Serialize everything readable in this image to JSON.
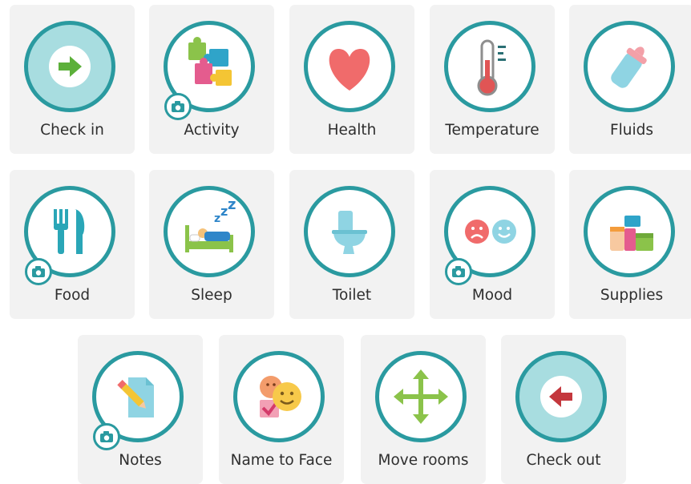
{
  "tiles": [
    {
      "label": "Check in",
      "icon": "arrow-right-icon"
    },
    {
      "label": "Activity",
      "icon": "puzzle-icon"
    },
    {
      "label": "Health",
      "icon": "heart-icon"
    },
    {
      "label": "Temperature",
      "icon": "thermometer-icon"
    },
    {
      "label": "Fluids",
      "icon": "baby-bottle-icon"
    },
    {
      "label": "Food",
      "icon": "fork-knife-icon"
    },
    {
      "label": "Sleep",
      "icon": "bed-icon"
    },
    {
      "label": "Toilet",
      "icon": "toilet-icon"
    },
    {
      "label": "Mood",
      "icon": "faces-icon"
    },
    {
      "label": "Supplies",
      "icon": "supplies-icon"
    },
    {
      "label": "Notes",
      "icon": "note-pencil-icon"
    },
    {
      "label": "Name to Face",
      "icon": "name-to-face-icon"
    },
    {
      "label": "Move rooms",
      "icon": "move-arrows-icon"
    },
    {
      "label": "Check out",
      "icon": "arrow-left-icon"
    }
  ],
  "colors": {
    "ring": "#2a9aa0",
    "tile_bg": "#f2f2f2",
    "check_fill": "#a8dde0",
    "check_in_arrow": "#5cb03a",
    "check_out_arrow": "#c4373d"
  }
}
